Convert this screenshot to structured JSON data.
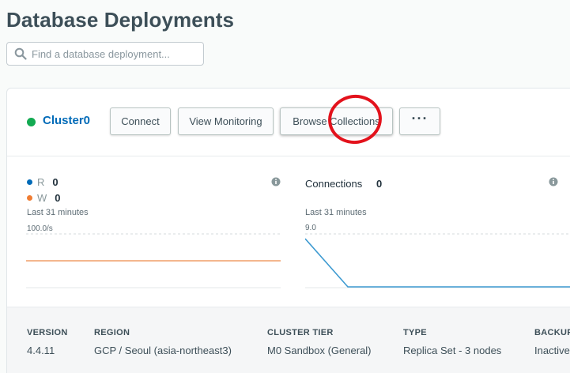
{
  "page": {
    "title": "Database Deployments"
  },
  "search": {
    "placeholder": "Find a database deployment..."
  },
  "cluster": {
    "name": "Cluster0",
    "status_color": "#13aa52",
    "buttons": {
      "connect": "Connect",
      "view_monitoring": "View Monitoring",
      "browse_collections": "Browse Collections",
      "more": "···"
    }
  },
  "metrics": {
    "ops": {
      "r_label": "R",
      "r_value": "0",
      "r_color": "#016bb8",
      "w_label": "W",
      "w_value": "0",
      "w_color": "#f07d33",
      "period": "Last 31 minutes",
      "max_label": "100.0/s"
    },
    "connections": {
      "label": "Connections",
      "value": "0",
      "period": "Last 31 minutes",
      "max_label": "9.0",
      "series_color": "#3d9ad1"
    }
  },
  "details": {
    "version": {
      "label": "VERSION",
      "value": "4.4.11"
    },
    "region": {
      "label": "REGION",
      "value": "GCP / Seoul (asia-northeast3)"
    },
    "tier": {
      "label": "CLUSTER TIER",
      "value": "M0 Sandbox (General)"
    },
    "type": {
      "label": "TYPE",
      "value": "Replica Set - 3 nodes"
    },
    "backups": {
      "label": "BACKUPS",
      "value": "Inactive"
    }
  },
  "annotation": {
    "color": "#e3121c"
  }
}
